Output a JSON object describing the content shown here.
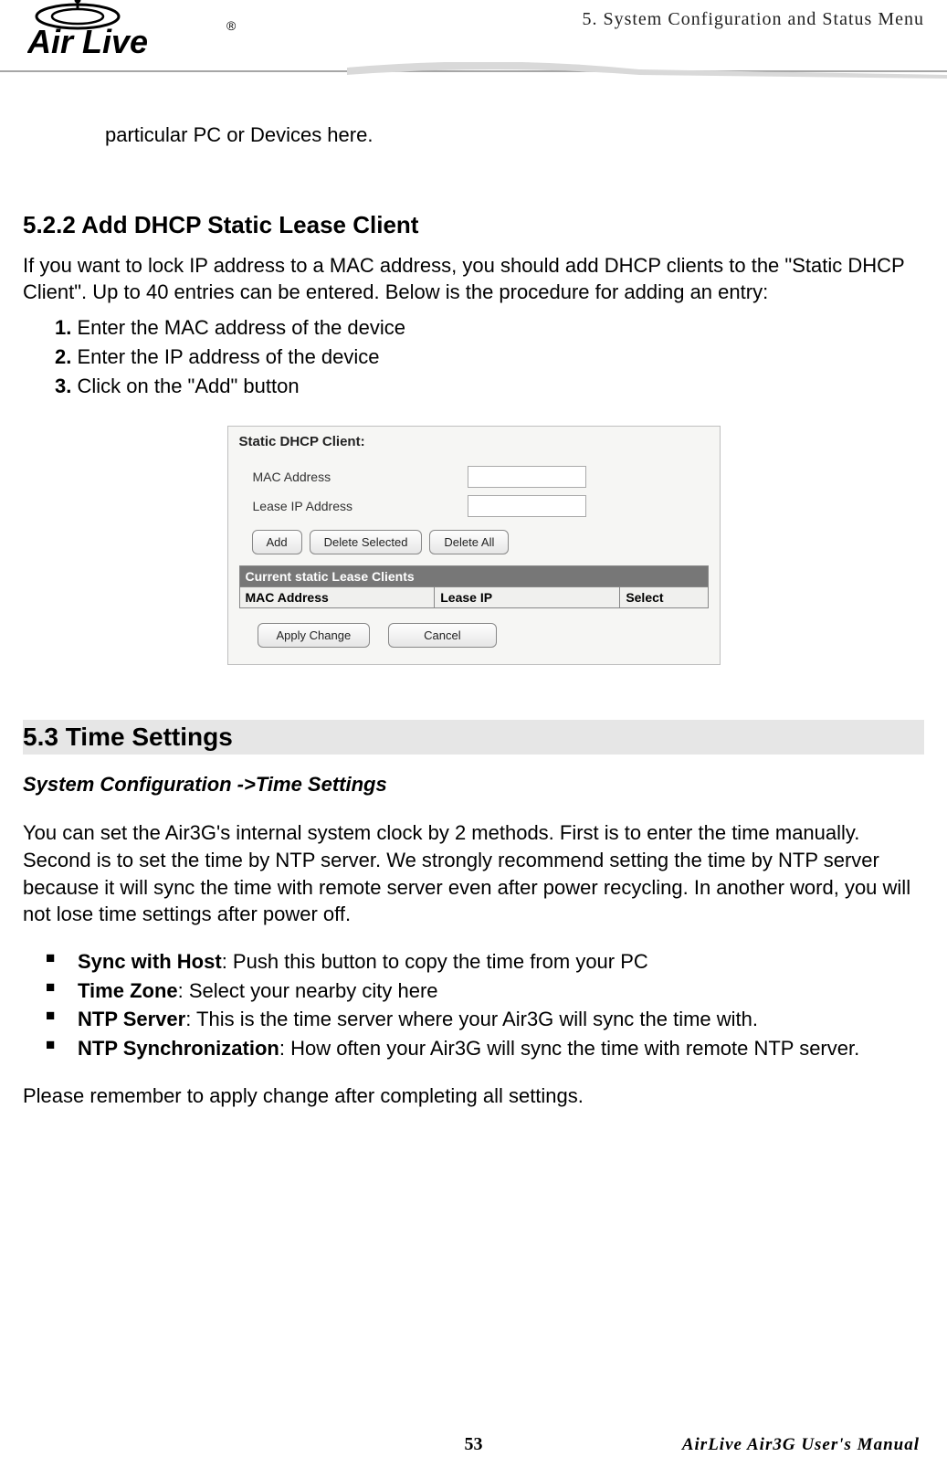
{
  "header": {
    "chapter_title": "5. System Configuration and Status Menu",
    "logo_text": "Air Live",
    "logo_r": "®"
  },
  "carry_text": "particular PC or Devices here.",
  "section_522": {
    "heading": "5.2.2   Add DHCP Static Lease Client",
    "intro": "If you want to lock IP address to a MAC address, you should add DHCP clients to the \"Static DHCP Client\".    Up to 40 entries can be entered.    Below is the procedure for adding an entry:",
    "steps": [
      "Enter the MAC address of the device",
      "Enter the IP address of the device",
      "Click on the \"Add\" button"
    ]
  },
  "panel": {
    "title": "Static DHCP Client:",
    "labels": {
      "mac": "MAC Address",
      "lease_ip": "Lease IP Address"
    },
    "inputs": {
      "mac": "",
      "lease_ip": ""
    },
    "buttons": {
      "add": "Add",
      "delete_selected": "Delete Selected",
      "delete_all": "Delete All",
      "apply_change": "Apply Change",
      "cancel": "Cancel"
    },
    "table": {
      "caption": "Current static Lease Clients",
      "headers": {
        "mac": "MAC Address",
        "lease": "Lease IP",
        "select": "Select"
      }
    }
  },
  "section_53": {
    "heading": "5.3 Time  Settings",
    "path": "System Configuration ->Time Settings",
    "intro": "You can set the Air3G's internal system clock by 2 methods.    First is to enter the time manually.    Second is to set the time by NTP server.    We strongly recommend setting the time by NTP server because it will sync the time with remote server even after power recycling.    In another word, you will not lose time settings after power off.",
    "bullets": [
      {
        "b": "Sync with Host",
        "rest": ":    Push this button to copy the time from your PC"
      },
      {
        "b": "Time Zone",
        "rest": ":    Select your nearby city here"
      },
      {
        "b": "NTP Server",
        "rest": ":    This is the time server where your Air3G will sync the time with."
      },
      {
        "b": "NTP Synchronization",
        "rest": ":    How often your Air3G will sync the time with remote NTP server."
      }
    ],
    "closing": "Please remember to apply change after completing all settings."
  },
  "footer": {
    "page_num": "53",
    "right_text": "AirLive Air3G User's Manual"
  }
}
